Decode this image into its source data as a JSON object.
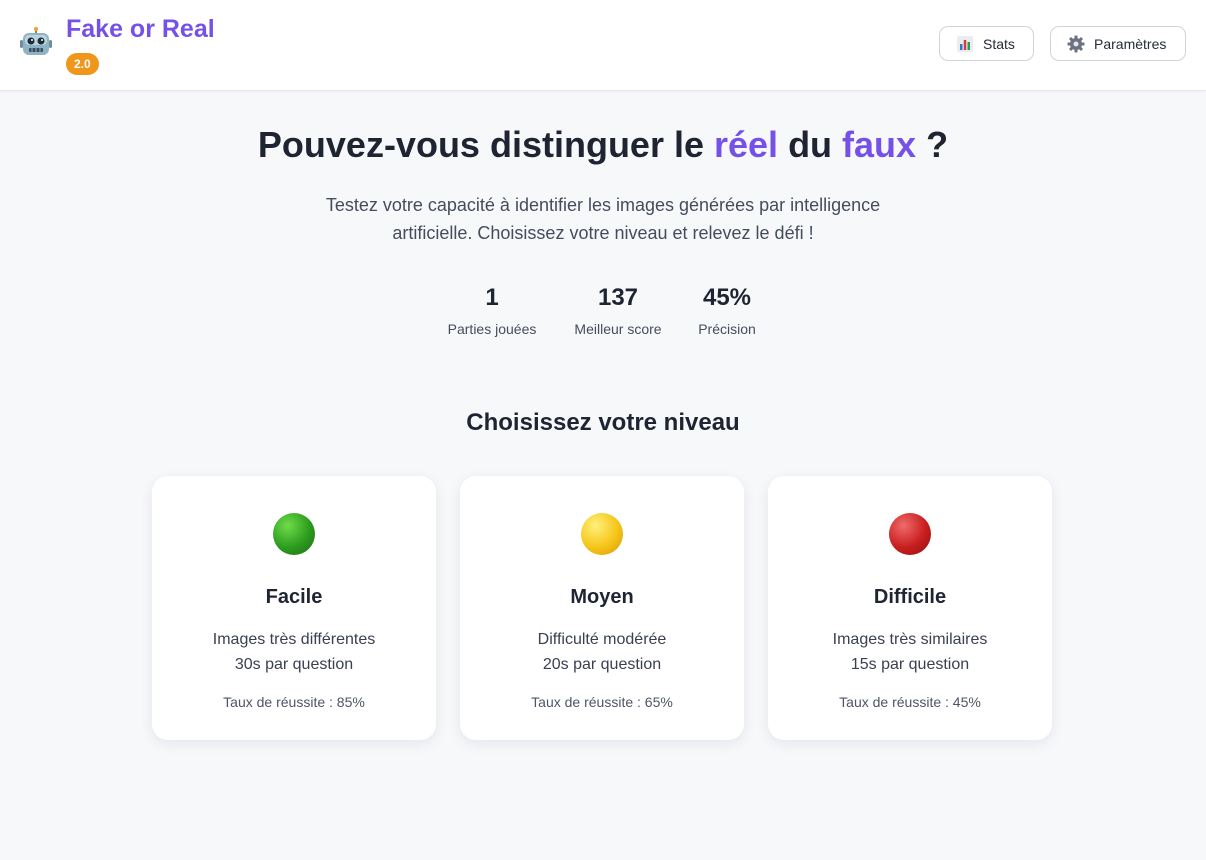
{
  "header": {
    "title": "Fake or Real",
    "version": "2.0",
    "stats_label": "Stats",
    "settings_label": "Paramètres"
  },
  "hero": {
    "title_part1": "Pouvez-vous distinguer le ",
    "title_accent1": "réel",
    "title_part2": " du ",
    "title_accent2": "faux",
    "title_part3": " ?",
    "subtitle": "Testez votre capacité à identifier les images générées par intelligence artificielle. Choisissez votre niveau et relevez le défi !"
  },
  "stats": [
    {
      "value": "1",
      "label": "Parties jouées"
    },
    {
      "value": "137",
      "label": "Meilleur score"
    },
    {
      "value": "45%",
      "label": "Précision"
    }
  ],
  "levels": {
    "title": "Choisissez votre niveau",
    "items": [
      {
        "name": "Facile",
        "desc1": "Images très différentes",
        "desc2": "30s par question",
        "rate": "Taux de réussite : 85%",
        "color": "#2d9b1e"
      },
      {
        "name": "Moyen",
        "desc1": "Difficulté modérée",
        "desc2": "20s par question",
        "rate": "Taux de réussite : 65%",
        "color": "#f5c518"
      },
      {
        "name": "Difficile",
        "desc1": "Images très similaires",
        "desc2": "15s par question",
        "rate": "Taux de réussite : 45%",
        "color": "#c81e1e"
      }
    ]
  },
  "icons": {
    "logo": "robot-icon",
    "stats": "bar-chart-icon",
    "settings": "gear-icon"
  },
  "colors": {
    "accent": "#7651e8",
    "badge": "#f0961b"
  }
}
